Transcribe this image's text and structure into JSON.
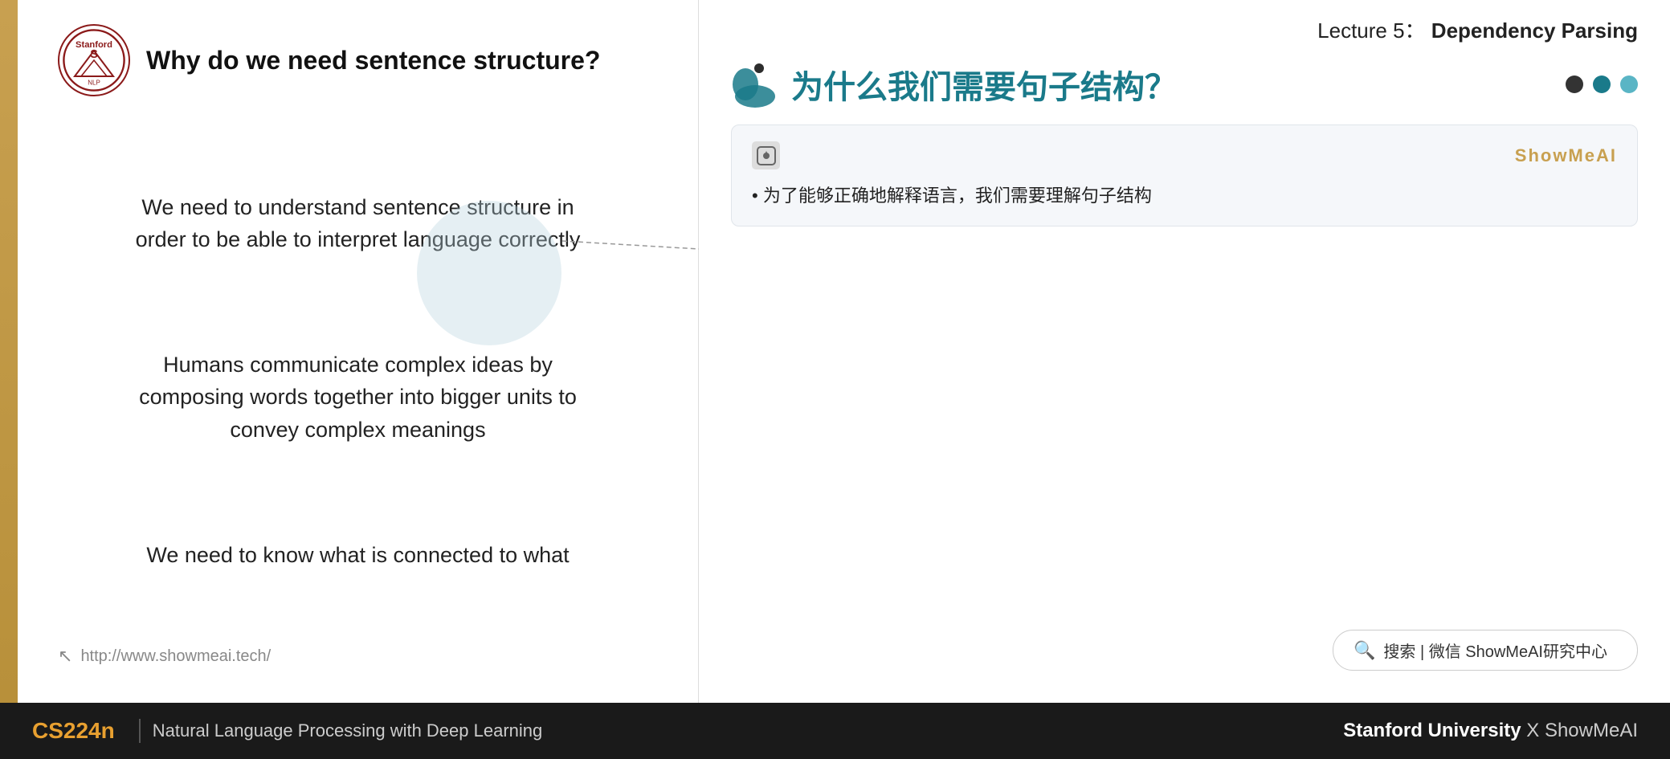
{
  "header": {
    "lecture_label": "Lecture 5：",
    "lecture_topic": "Dependency Parsing"
  },
  "slide": {
    "title": "Why do we need sentence structure?",
    "paragraph1": "We need to understand sentence structure in\norder to be able to interpret language correctly",
    "paragraph2": "Humans communicate complex ideas by\ncomposing words together into bigger units to\nconvey complex meanings",
    "paragraph3": "We need to know what is connected to what",
    "footer_url": "http://www.showmeai.tech/",
    "logo_text": "S NLP"
  },
  "right": {
    "chinese_heading": "为什么我们需要句子结构？",
    "card": {
      "brand": "ShowMeAI",
      "bullet": "为了能够正确地解释语言，我们需要理解句子结构"
    }
  },
  "search": {
    "label": "搜索 | 微信 ShowMeAI研究中心"
  },
  "bottom": {
    "cs_code": "CS224n",
    "divider": "|",
    "subtitle": "Natural Language Processing with Deep Learning",
    "right_text": "Stanford University",
    "x_text": "X ShowMeAI"
  },
  "dots": [
    {
      "color": "#2d2d2d"
    },
    {
      "color": "#1a7a8a"
    },
    {
      "color": "#5ab5c5"
    }
  ]
}
